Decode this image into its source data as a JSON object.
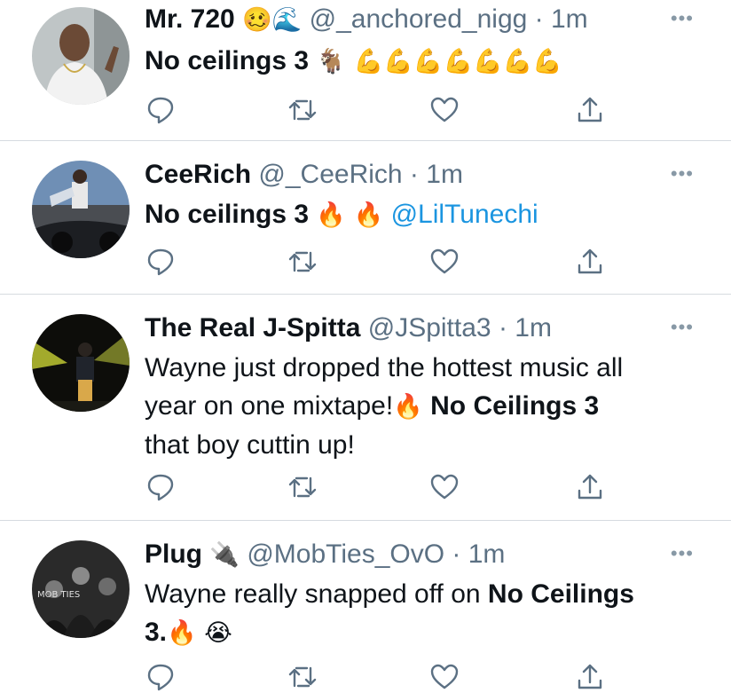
{
  "tweets": [
    {
      "name": "Mr. 720",
      "emojis": "🥴🌊",
      "handle": "@_anchored_nigg",
      "dot": "·",
      "time": "1m",
      "more": "•••",
      "body_text": "No ceilings 3",
      "body_emoji": "🐐 💪💪💪💪💪💪💪"
    },
    {
      "name": "CeeRich",
      "handle": "@_CeeRich",
      "dot": "·",
      "time": "1m",
      "more": "•••",
      "body_text": "No ceilings 3",
      "body_emoji": "🔥 🔥",
      "mention": "@LilTunechi"
    },
    {
      "name": "The Real J-Spitta",
      "handle": "@JSpitta3",
      "dot": "·",
      "time": "1m",
      "more": "•••",
      "line1": "Wayne just dropped the hottest music all",
      "line2_pre": "year on one mixtape!",
      "line2_emoji": "🔥",
      "line2_bold": "No Ceilings 3",
      "line3": "that boy cuttin up!"
    },
    {
      "name": "Plug",
      "emojis": "🔌",
      "handle": "@MobTies_OvO",
      "dot": "·",
      "time": "1m",
      "more": "•••",
      "line1_pre": "Wayne really snapped off on",
      "line1_bold": "No Ceilings",
      "line2_bold": "3.",
      "line2_emoji": "🔥 😭"
    }
  ]
}
